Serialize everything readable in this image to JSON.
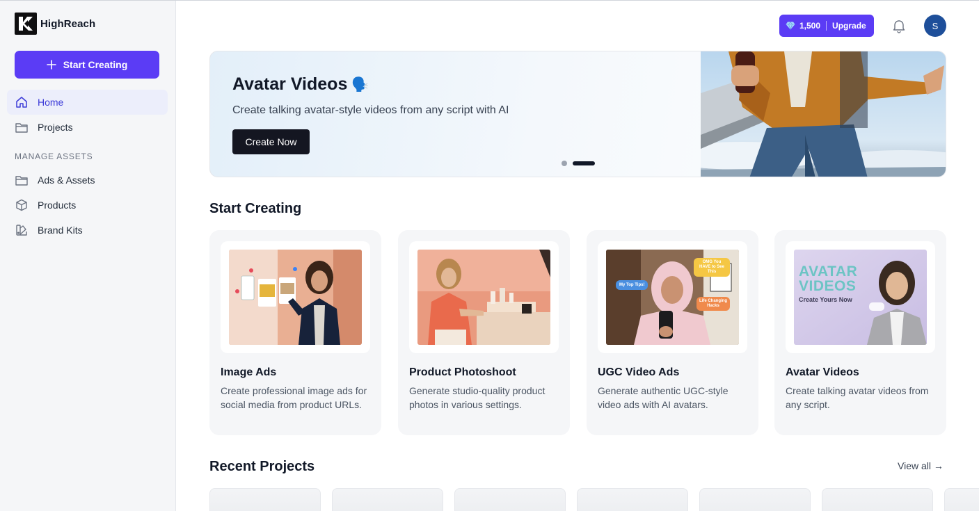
{
  "app": {
    "name": "HighReach"
  },
  "sidebar": {
    "start_button": "Start Creating",
    "items": [
      {
        "label": "Home",
        "icon": "home-icon",
        "active": true
      },
      {
        "label": "Projects",
        "icon": "folder-icon"
      }
    ],
    "section_label": "MANAGE ASSETS",
    "asset_items": [
      {
        "label": "Ads & Assets",
        "icon": "folder-icon"
      },
      {
        "label": "Products",
        "icon": "cube-icon"
      },
      {
        "label": "Brand Kits",
        "icon": "brand-kit-icon"
      }
    ]
  },
  "header": {
    "credits": "1,500",
    "upgrade": "Upgrade",
    "avatar_initial": "S",
    "colors": {
      "accent": "#5b3cf5",
      "avatar": "#1e4f9a"
    }
  },
  "hero": {
    "title": "Avatar Videos",
    "emoji": "🗣️",
    "subtitle": "Create talking avatar-style videos from any script with AI",
    "button": "Create Now",
    "slides": 2,
    "active_slide": 2
  },
  "start_creating": {
    "title": "Start Creating",
    "cards": [
      {
        "title": "Image Ads",
        "desc": "Create professional image ads for social media from product URLs."
      },
      {
        "title": "Product Photoshoot",
        "desc": "Generate studio-quality product photos in various settings."
      },
      {
        "title": "UGC Video Ads",
        "desc": "Generate authentic UGC-style video ads with AI avatars."
      },
      {
        "title": "Avatar Videos",
        "desc": "Create talking avatar videos from any script."
      }
    ],
    "thumb_text": {
      "ugc_bubble1": "OMG You HAVE to See This",
      "ugc_bubble2": "My Top Tips!",
      "ugc_bubble3": "Life Changing Hacks",
      "avatar_line1": "AVATAR",
      "avatar_line2": "VIDEOS",
      "avatar_line3": "Create Yours Now"
    }
  },
  "recent": {
    "title": "Recent Projects",
    "view_all": "View all →"
  }
}
